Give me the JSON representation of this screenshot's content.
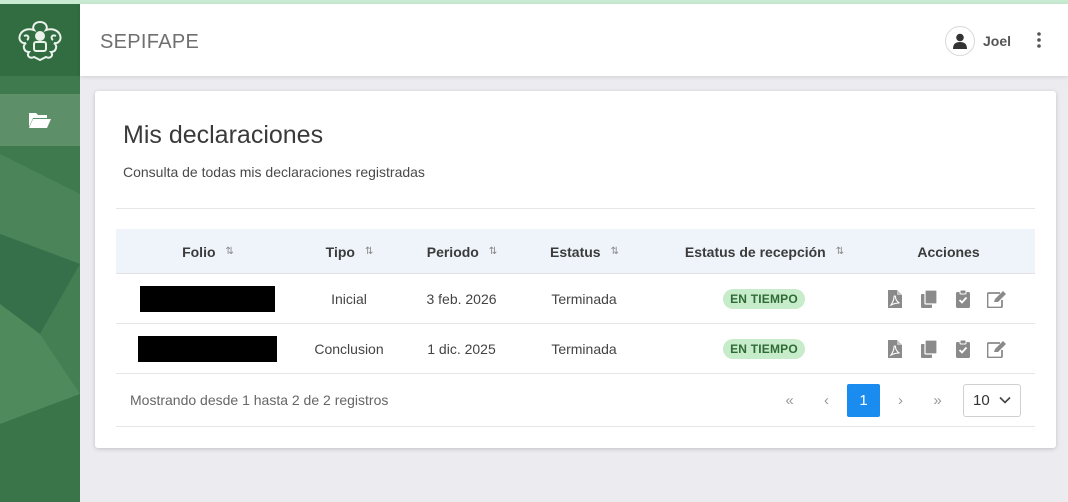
{
  "app": {
    "title": "SEPIFAPE"
  },
  "user": {
    "name": "Joel"
  },
  "page": {
    "title": "Mis declaraciones",
    "subtitle": "Consulta de todas mis declaraciones registradas"
  },
  "table": {
    "columns": [
      {
        "label": "Folio",
        "sort_icon": "⇅"
      },
      {
        "label": "Tipo",
        "sort_icon": "⇅"
      },
      {
        "label": "Periodo",
        "sort_icon": "⇅"
      },
      {
        "label": "Estatus",
        "sort_icon": "⇅"
      },
      {
        "label": "Estatus de recepción",
        "sort_icon": "⇅"
      },
      {
        "label": "Acciones"
      }
    ],
    "rows": [
      {
        "folio": "",
        "tipo": "Inicial",
        "periodo": "3 feb. 2026",
        "estatus": "Terminada",
        "recepcion": "EN TIEMPO"
      },
      {
        "folio": "",
        "tipo": "Conclusion",
        "periodo": "1 dic. 2025",
        "estatus": "Terminada",
        "recepcion": "EN TIEMPO"
      }
    ],
    "row_actions": [
      "pdf-icon",
      "copy-icon",
      "clipboard-check-icon",
      "edit-icon"
    ]
  },
  "pagination": {
    "info": "Mostrando desde 1 hasta 2 de 2 registros",
    "first": "«",
    "prev": "‹",
    "current": "1",
    "next": "›",
    "last": "»",
    "page_size": "10"
  },
  "colors": {
    "sidebar": "#3f7a4e",
    "accent": "#1a8cf0",
    "badge_bg": "#c7ecc9",
    "badge_text": "#2f6b36"
  }
}
